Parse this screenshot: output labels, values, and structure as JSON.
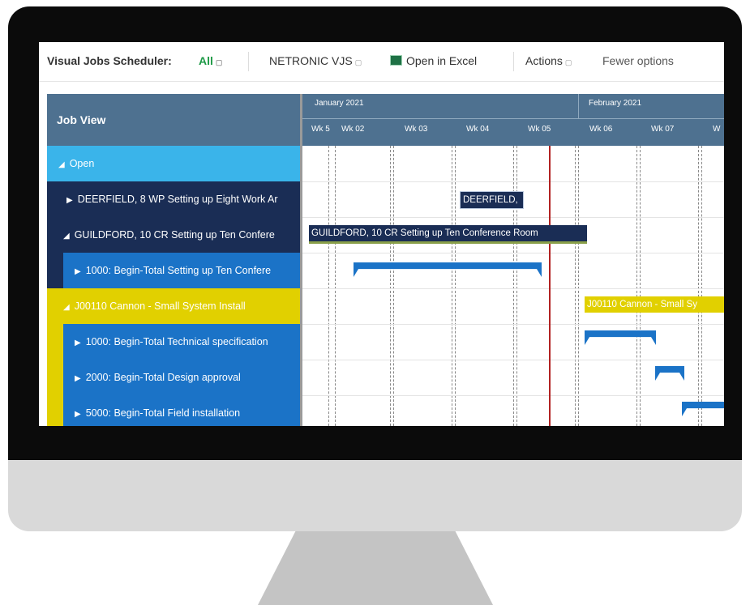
{
  "toolbar": {
    "title": "Visual Jobs Scheduler:",
    "filter_all": "All",
    "netronic": "NETRONIC VJS",
    "open_excel": "Open in Excel",
    "actions": "Actions",
    "fewer_options": "Fewer options"
  },
  "job_view": {
    "header": "Job View",
    "rows": [
      {
        "label": "Open"
      },
      {
        "label": "DEERFIELD, 8 WP Setting up Eight Work Ar"
      },
      {
        "label": "GUILDFORD, 10 CR Setting up Ten Confere"
      },
      {
        "label": "1000: Begin-Total Setting up Ten Confere"
      },
      {
        "label": "J00110 Cannon - Small System Install"
      },
      {
        "label": "1000: Begin-Total Technical specification"
      },
      {
        "label": "2000: Begin-Total Design approval"
      },
      {
        "label": "5000: Begin-Total Field installation"
      }
    ]
  },
  "gantt": {
    "months": [
      "January 2021",
      "February 2021"
    ],
    "weeks": [
      "Wk 5",
      "Wk 02",
      "Wk 03",
      "Wk 04",
      "Wk 05",
      "Wk 06",
      "Wk 07",
      "W"
    ],
    "bars": {
      "deerfield": "DEERFIELD,",
      "guildford": "GUILDFORD, 10 CR Setting up Ten Conference Room",
      "cannon": "J00110 Cannon - Small Sy"
    }
  },
  "colors": {
    "navy": "#1a2d55",
    "blue": "#1b73c7",
    "lightblue": "#3ab4ea",
    "yellow": "#e1d000",
    "header": "#4e7190",
    "today_line": "#b22222"
  }
}
